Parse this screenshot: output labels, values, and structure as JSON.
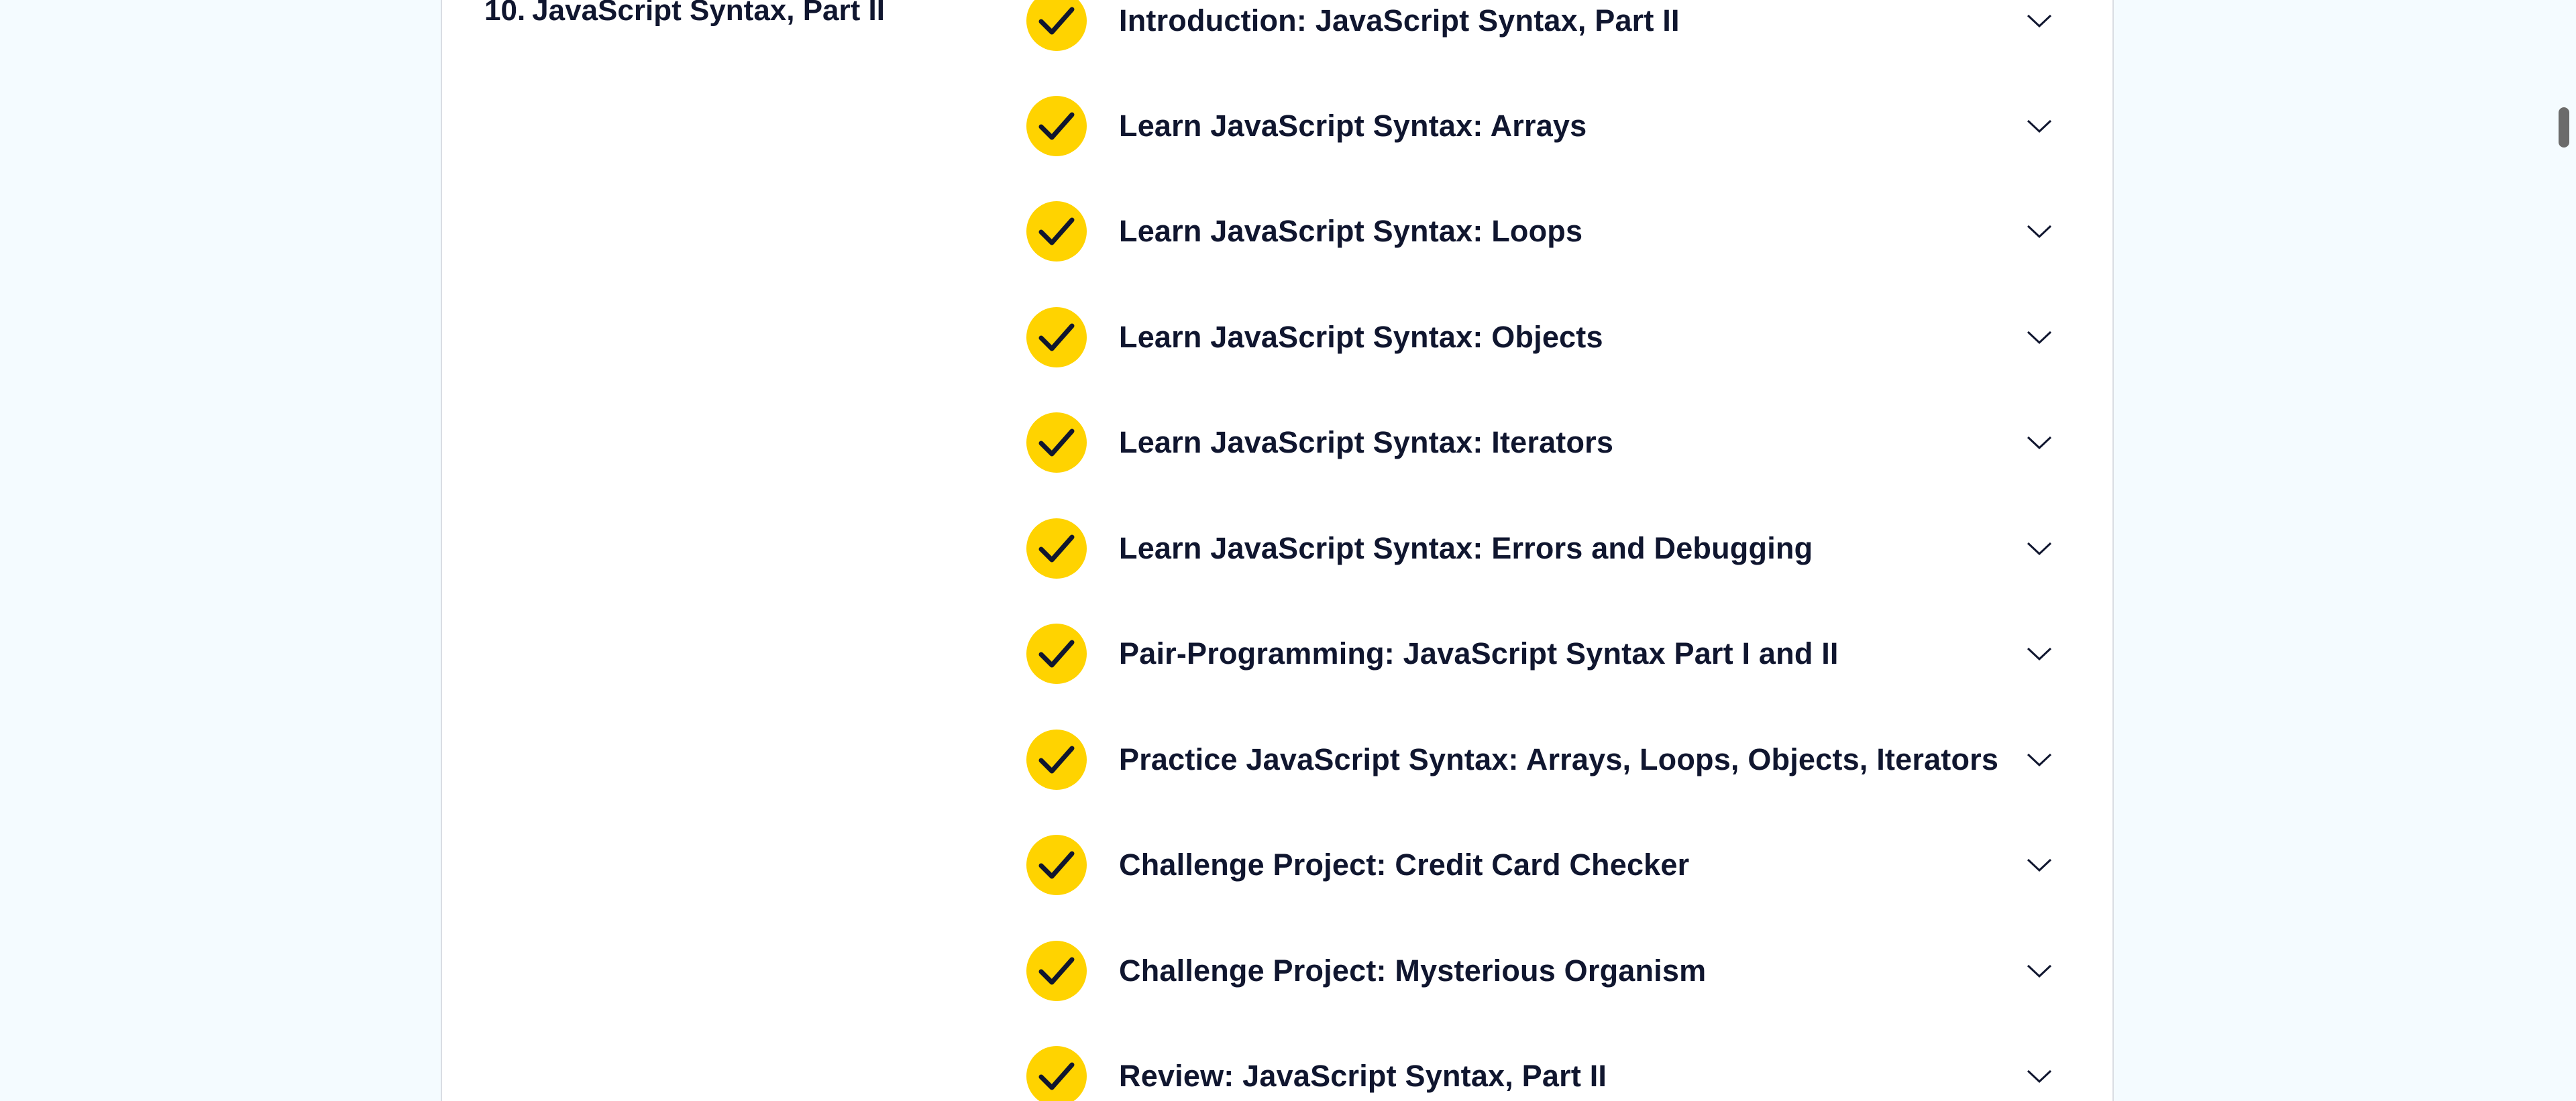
{
  "module": {
    "number": "10.",
    "title": "JavaScript Syntax, Part II"
  },
  "items": [
    {
      "label": "Introduction: JavaScript Syntax, Part II",
      "completed": true
    },
    {
      "label": "Learn JavaScript Syntax: Arrays",
      "completed": true
    },
    {
      "label": "Learn JavaScript Syntax: Loops",
      "completed": true
    },
    {
      "label": "Learn JavaScript Syntax: Objects",
      "completed": true
    },
    {
      "label": "Learn JavaScript Syntax: Iterators",
      "completed": true
    },
    {
      "label": "Learn JavaScript Syntax: Errors and Debugging",
      "completed": true
    },
    {
      "label": "Pair-Programming: JavaScript Syntax Part I and II",
      "completed": true
    },
    {
      "label": "Practice JavaScript Syntax: Arrays, Loops, Objects, Iterators",
      "completed": true
    },
    {
      "label": "Challenge Project: Credit Card Checker",
      "completed": true
    },
    {
      "label": "Challenge Project: Mysterious Organism",
      "completed": true
    },
    {
      "label": "Review: JavaScript Syntax, Part II",
      "completed": true
    }
  ],
  "icons": {
    "status": "check-circle-icon",
    "expand": "chevron-down-icon"
  },
  "colors": {
    "check_badge": "#ffd300",
    "text": "#10162f",
    "page_background": "#f4fbff",
    "card_background": "#ffffff"
  }
}
